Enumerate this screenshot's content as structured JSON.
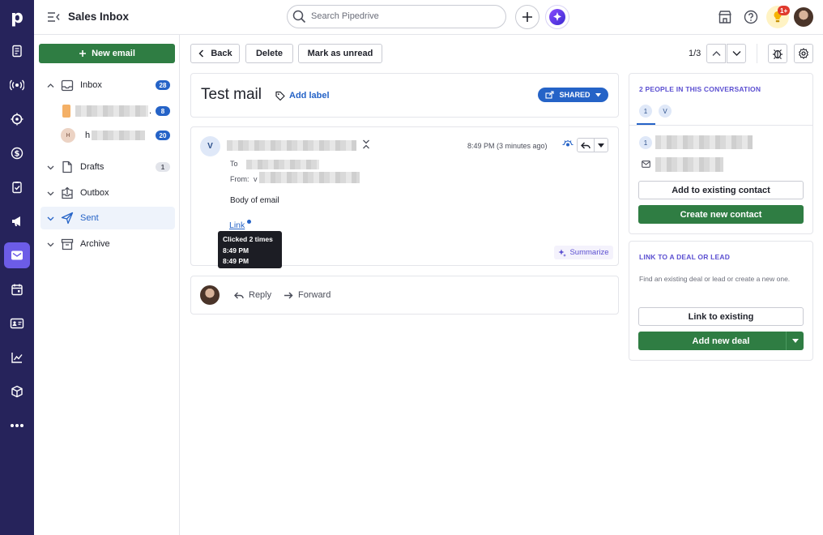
{
  "rail": {
    "logo": "p",
    "items": [
      "leads-icon",
      "activity-feed-icon",
      "target-icon",
      "deals-icon",
      "tasks-icon",
      "campaigns-icon",
      "mail-icon",
      "calendar-icon",
      "contacts-icon",
      "insights-icon",
      "products-icon",
      "more-icon"
    ]
  },
  "header": {
    "title": "Sales Inbox",
    "search_placeholder": "Search Pipedrive",
    "notification_badge": "1+"
  },
  "sidebar": {
    "new_email": "New email",
    "inbox": {
      "label": "Inbox",
      "count": "28"
    },
    "inbox_accounts": [
      {
        "initial": "",
        "suffix": ".",
        "count": "8"
      },
      {
        "initial": "H",
        "prefix": "h",
        "count": "20"
      }
    ],
    "drafts": {
      "label": "Drafts",
      "count": "1"
    },
    "outbox": {
      "label": "Outbox"
    },
    "sent": {
      "label": "Sent"
    },
    "archive": {
      "label": "Archive"
    }
  },
  "toolbar": {
    "back": "Back",
    "delete": "Delete",
    "mark_unread": "Mark as unread",
    "pager": "1/3"
  },
  "mail": {
    "subject": "Test mail",
    "add_label": "Add label",
    "shared": "SHARED",
    "sender_initial": "V",
    "time": "8:49 PM (3 minutes ago)",
    "to_label": "To",
    "from_label": "From:",
    "from_prefix": "v",
    "body": "Body of email",
    "link_text": "Link",
    "tooltip_title": "Clicked 2 times",
    "tooltip_times": [
      "8:49 PM",
      "8:49 PM"
    ],
    "summarize": "Summarize",
    "reply": "Reply",
    "forward": "Forward"
  },
  "people_panel": {
    "heading": "2 PEOPLE IN THIS CONVERSATION",
    "tabs": [
      "1",
      "V"
    ],
    "person_badge": "1",
    "add_existing": "Add to existing contact",
    "create_new": "Create new contact"
  },
  "deal_panel": {
    "heading": "LINK TO A DEAL OR LEAD",
    "description": "Find an existing deal or lead or create a new one.",
    "link_existing": "Link to existing",
    "add_deal": "Add new deal"
  },
  "colors": {
    "rail": "#26235b",
    "accent_green": "#2f7d43",
    "link_blue": "#2563c7",
    "active_purple": "#6c5ce7"
  }
}
